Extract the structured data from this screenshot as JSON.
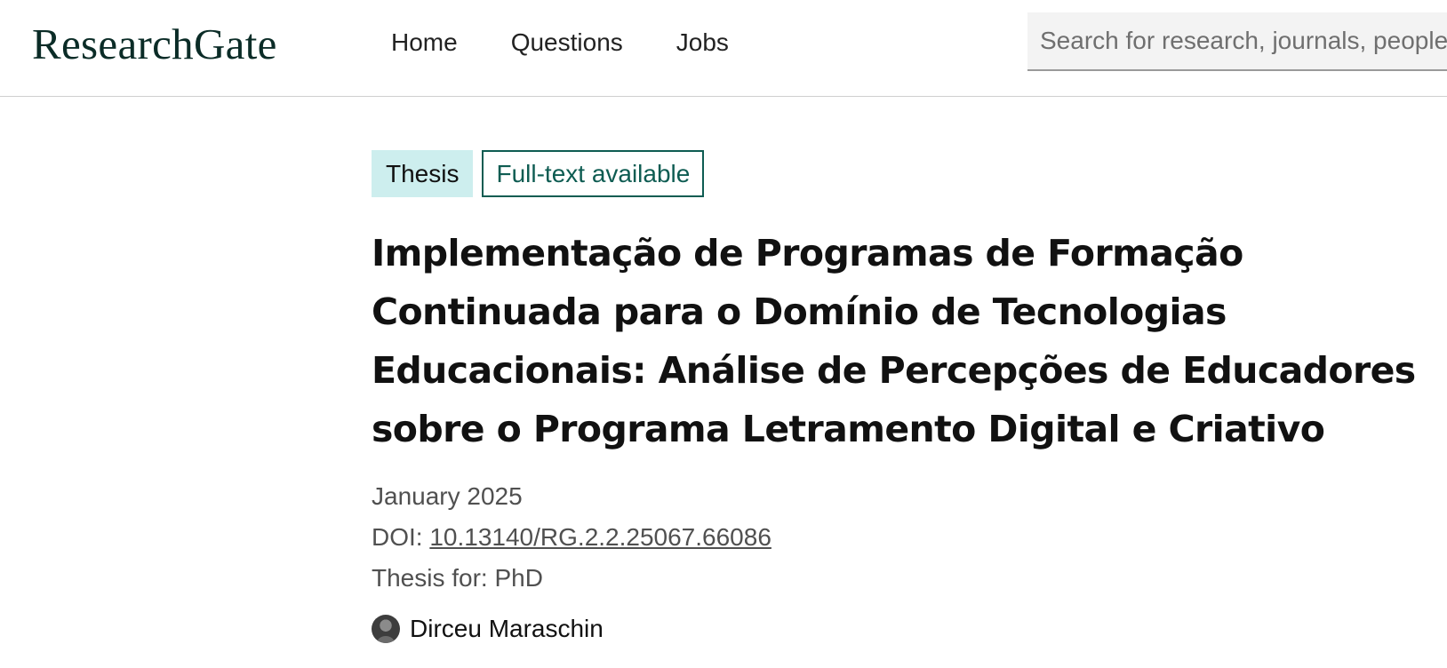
{
  "header": {
    "logo_text": "ResearchGate",
    "nav": {
      "home": "Home",
      "questions": "Questions",
      "jobs": "Jobs"
    },
    "search": {
      "placeholder": "Search for research, journals, people"
    }
  },
  "publication": {
    "type_badge": "Thesis",
    "fulltext_badge": "Full-text available",
    "title": "Implementação de Programas de Formação Continuada para o Domínio de Tecnologias Educacionais: Análise de Percepções de Educadores sobre o Programa Letramento Digital e Criativo",
    "date": "January 2025",
    "doi_label": "DOI: ",
    "doi_value": "10.13140/RG.2.2.25067.66086",
    "thesis_for": "Thesis for: PhD",
    "author": {
      "name": "Dirceu Maraschin",
      "avatar_icon": "user-avatar-icon"
    }
  },
  "colors": {
    "brand_dark": "#0b2c27",
    "accent_teal": "#0e5c52",
    "badge_bg": "#cdeeee"
  }
}
